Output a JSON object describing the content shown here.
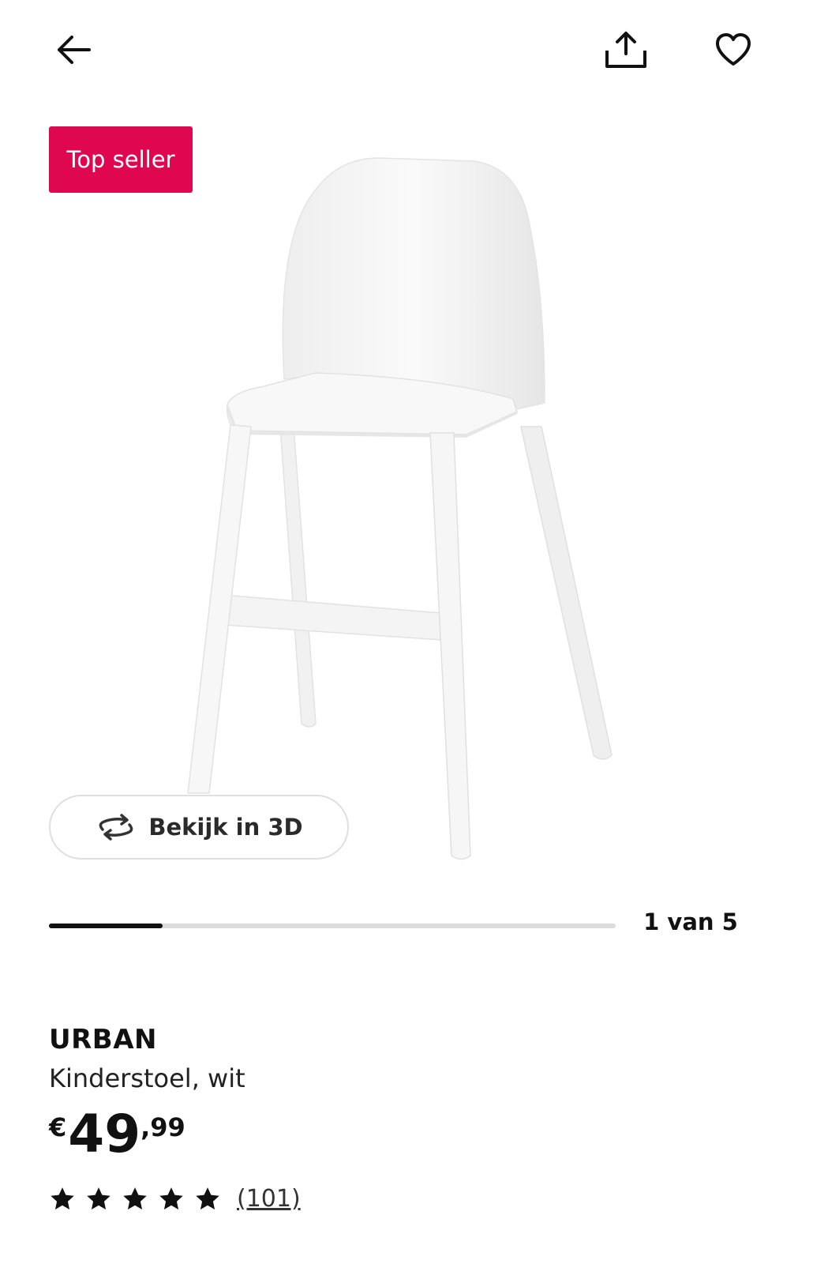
{
  "header": {
    "back_icon": "arrow-left-icon",
    "share_icon": "share-icon",
    "favourite_icon": "heart-icon"
  },
  "badge": {
    "label": "Top seller",
    "color": "#e00751"
  },
  "view_3d": {
    "label": "Bekijk in 3D",
    "icon": "rotate-3d-icon"
  },
  "gallery": {
    "current": 1,
    "total": 5,
    "counter_text": "1 van 5"
  },
  "product": {
    "name": "URBAN",
    "description": "Kinderstoel, wit",
    "price": {
      "currency": "€",
      "integer": "49",
      "decimal": ",99"
    },
    "rating": {
      "stars": 5,
      "max": 5,
      "review_count": "(101)"
    }
  }
}
